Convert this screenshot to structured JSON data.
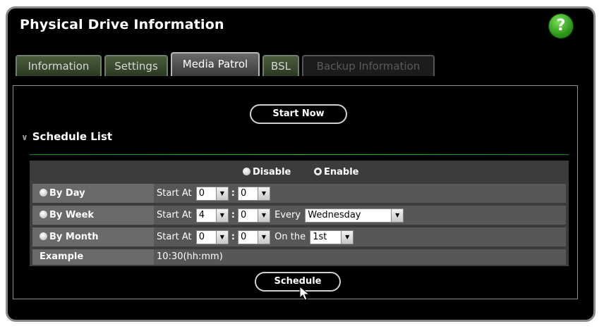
{
  "header": {
    "title": "Physical Drive Information",
    "help_label": "?"
  },
  "tabs": [
    {
      "label": "Information"
    },
    {
      "label": "Settings"
    },
    {
      "label": "Media Patrol"
    },
    {
      "label": "BSL"
    },
    {
      "label": "Backup Information"
    }
  ],
  "actions": {
    "start_now": "Start Now",
    "schedule": "Schedule"
  },
  "schedule": {
    "heading": "Schedule List",
    "disable_label": "Disable",
    "enable_label": "Enable",
    "by_day": {
      "label": "By Day",
      "start_at": "Start At",
      "hour": "0",
      "minute": "0"
    },
    "by_week": {
      "label": "By Week",
      "start_at": "Start At",
      "hour": "4",
      "minute": "0",
      "every_label": "Every",
      "day": "Wednesday"
    },
    "by_month": {
      "label": "By Month",
      "start_at": "Start At",
      "hour": "0",
      "minute": "0",
      "on_label": "On the",
      "day": "1st"
    },
    "example": {
      "label": "Example",
      "value": "10:30(hh:mm)"
    },
    "colon": ":"
  },
  "colors": {
    "tab_green": "#3d5030",
    "accent_line": "#2bc02b",
    "help_green": "#2e9a1c"
  }
}
